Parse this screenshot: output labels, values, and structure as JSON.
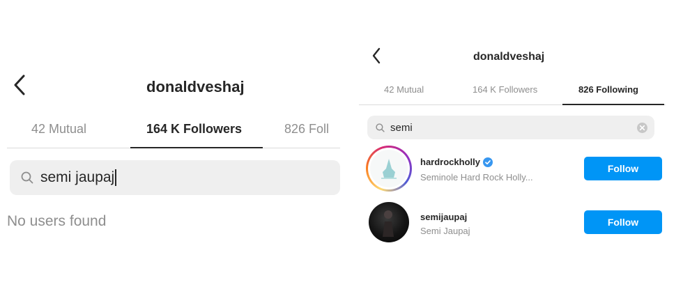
{
  "left_panel": {
    "title": "donaldveshaj",
    "tabs": [
      {
        "label": "42 Mutual"
      },
      {
        "label": "164 K Followers"
      },
      {
        "label": "826 Foll"
      }
    ],
    "active_tab": 1,
    "search": {
      "value": "semi jaupaj"
    },
    "empty_message": "No users found"
  },
  "right_panel": {
    "title": "donaldveshaj",
    "tabs": [
      {
        "label": "42 Mutual"
      },
      {
        "label": "164 K Followers"
      },
      {
        "label": "826 Following"
      }
    ],
    "active_tab": 2,
    "search": {
      "value": "semi"
    },
    "results": [
      {
        "username": "hardrockholly",
        "full_name": "Seminole Hard Rock Holly...",
        "verified": true,
        "button": "Follow",
        "has_story": true
      },
      {
        "username": "semijaupaj",
        "full_name": "Semi Jaupaj",
        "verified": false,
        "button": "Follow",
        "has_story": false
      }
    ]
  },
  "colors": {
    "accent": "#0095f6",
    "verified": "#3897f0",
    "muted": "#8e8e8e"
  },
  "icons": [
    "back-chevron-icon",
    "search-icon",
    "clear-icon",
    "verified-badge-icon"
  ]
}
